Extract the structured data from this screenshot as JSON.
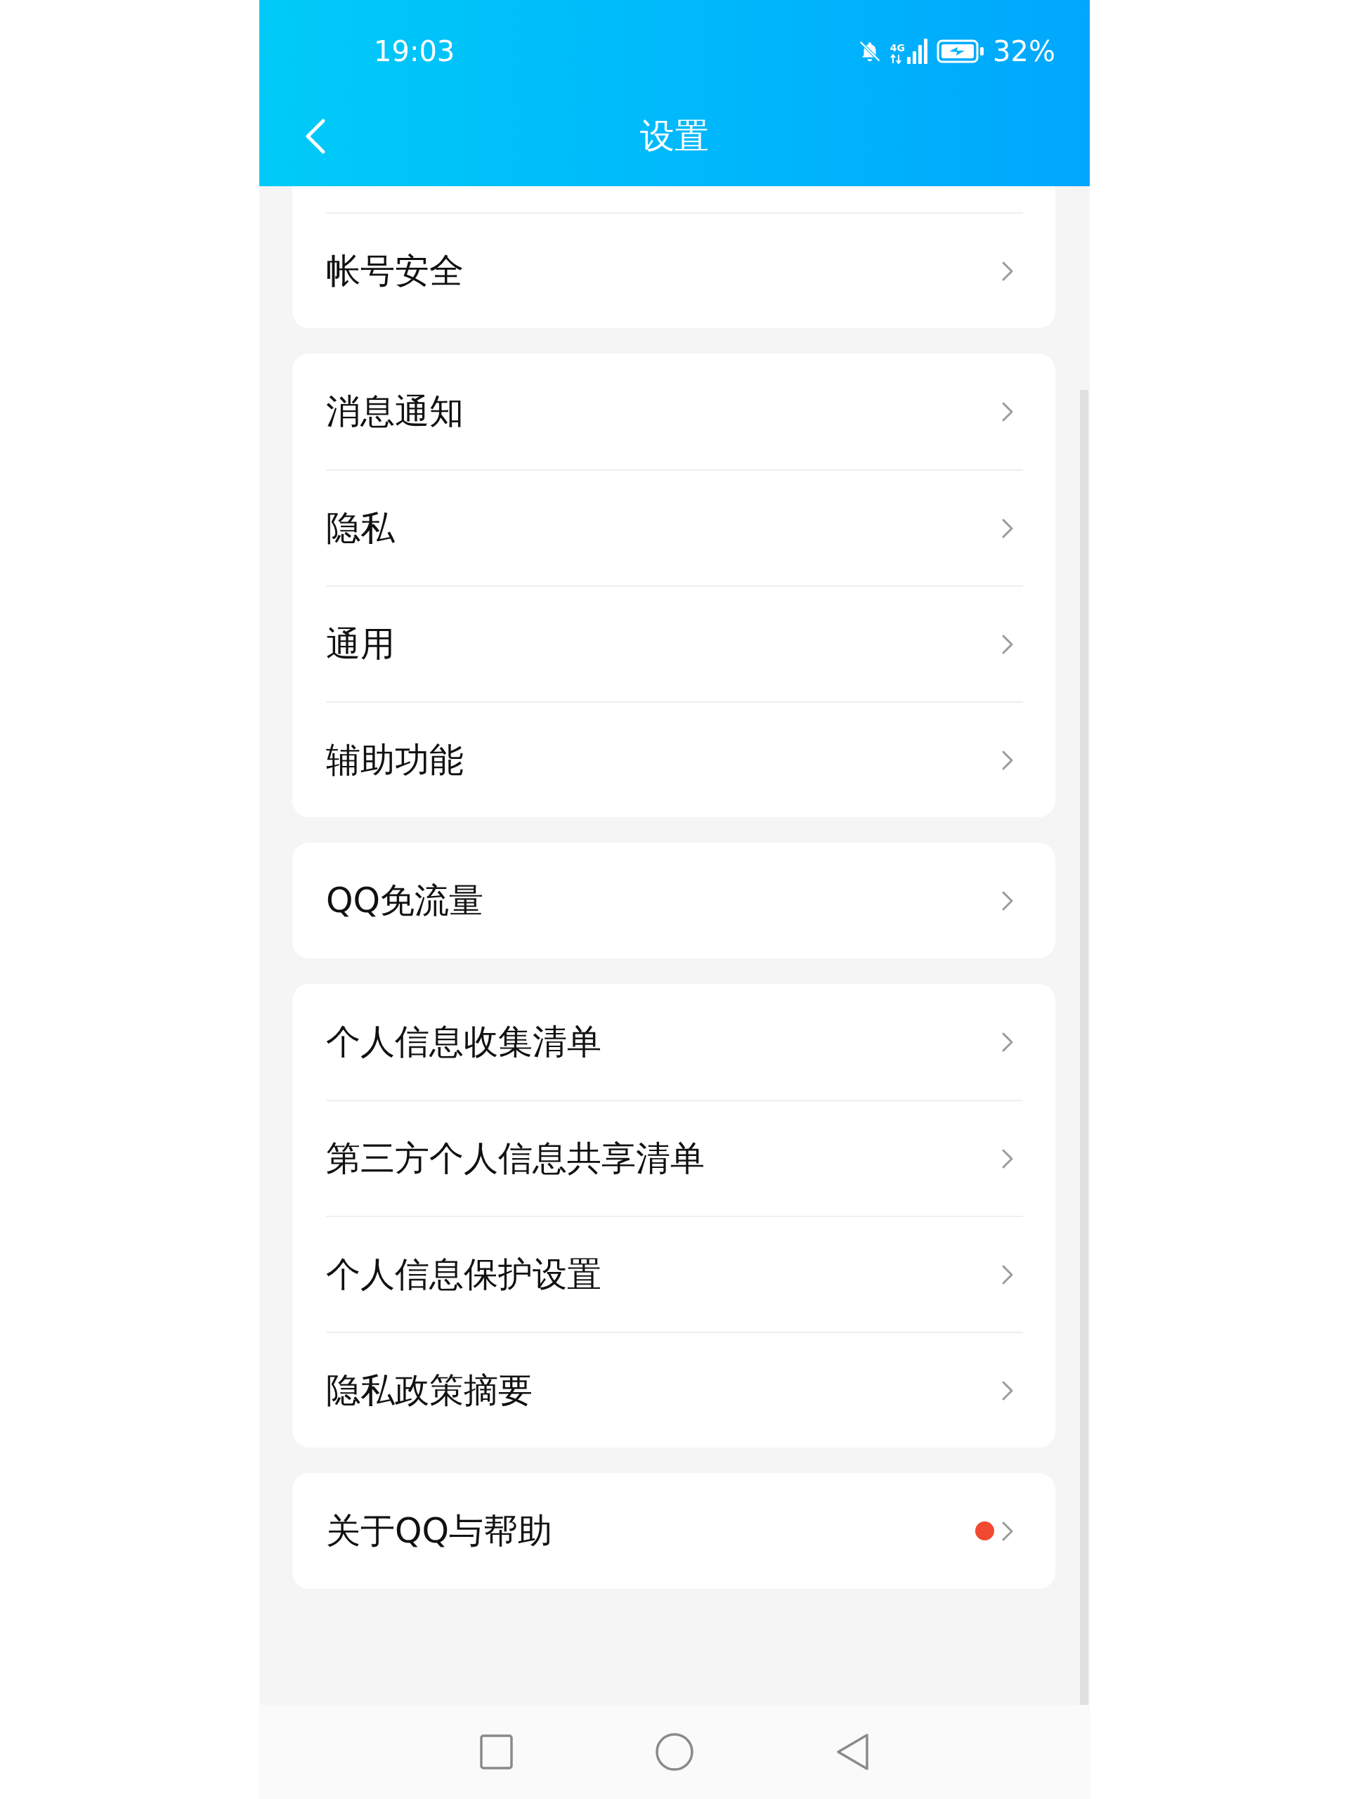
{
  "status_bar": {
    "time": "19:03",
    "network": "4G",
    "battery": "32%"
  },
  "header": {
    "title": "设置"
  },
  "groups": [
    {
      "clipped_top": true,
      "items": [
        {
          "label": "帐号安全",
          "dot": false
        }
      ]
    },
    {
      "clipped_top": false,
      "items": [
        {
          "label": "消息通知",
          "dot": false
        },
        {
          "label": "隐私",
          "dot": false
        },
        {
          "label": "通用",
          "dot": false
        },
        {
          "label": "辅助功能",
          "dot": false
        }
      ]
    },
    {
      "clipped_top": false,
      "items": [
        {
          "label": "QQ免流量",
          "dot": false
        }
      ]
    },
    {
      "clipped_top": false,
      "items": [
        {
          "label": "个人信息收集清单",
          "dot": false
        },
        {
          "label": "第三方个人信息共享清单",
          "dot": false
        },
        {
          "label": "个人信息保护设置",
          "dot": false
        },
        {
          "label": "隐私政策摘要",
          "dot": false
        }
      ]
    },
    {
      "clipped_top": false,
      "items": [
        {
          "label": "关于QQ与帮助",
          "dot": true
        }
      ]
    }
  ]
}
